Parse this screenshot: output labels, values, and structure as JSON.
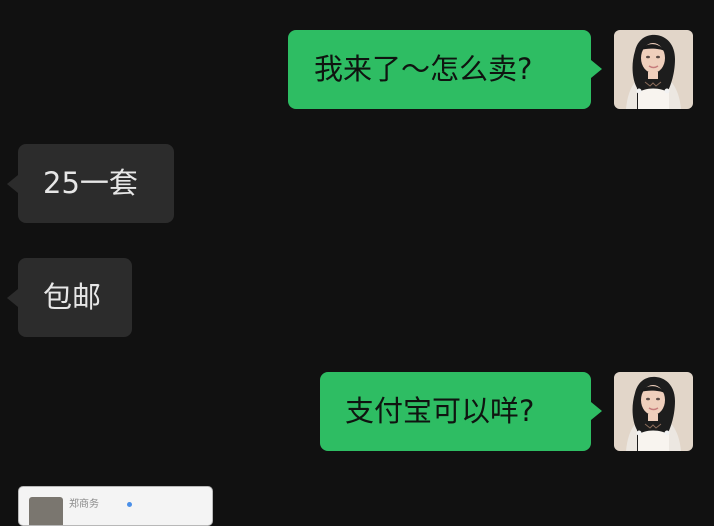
{
  "conversation": {
    "messages": [
      {
        "direction": "outgoing",
        "text": "我来了～怎么卖?"
      },
      {
        "direction": "incoming",
        "text": "25一套"
      },
      {
        "direction": "incoming",
        "text": "包邮"
      },
      {
        "direction": "outgoing",
        "text": "支付宝可以咩?"
      }
    ],
    "partial_card": {
      "title_fragment": "郑商务"
    }
  },
  "colors": {
    "background": "#111111",
    "outgoing_bubble": "#2ebd63",
    "incoming_bubble": "#2c2c2c",
    "incoming_text": "#e7e7e7"
  },
  "icons": {
    "avatar": "user-avatar-photo",
    "card_thumbnail": "card-thumbnail"
  }
}
